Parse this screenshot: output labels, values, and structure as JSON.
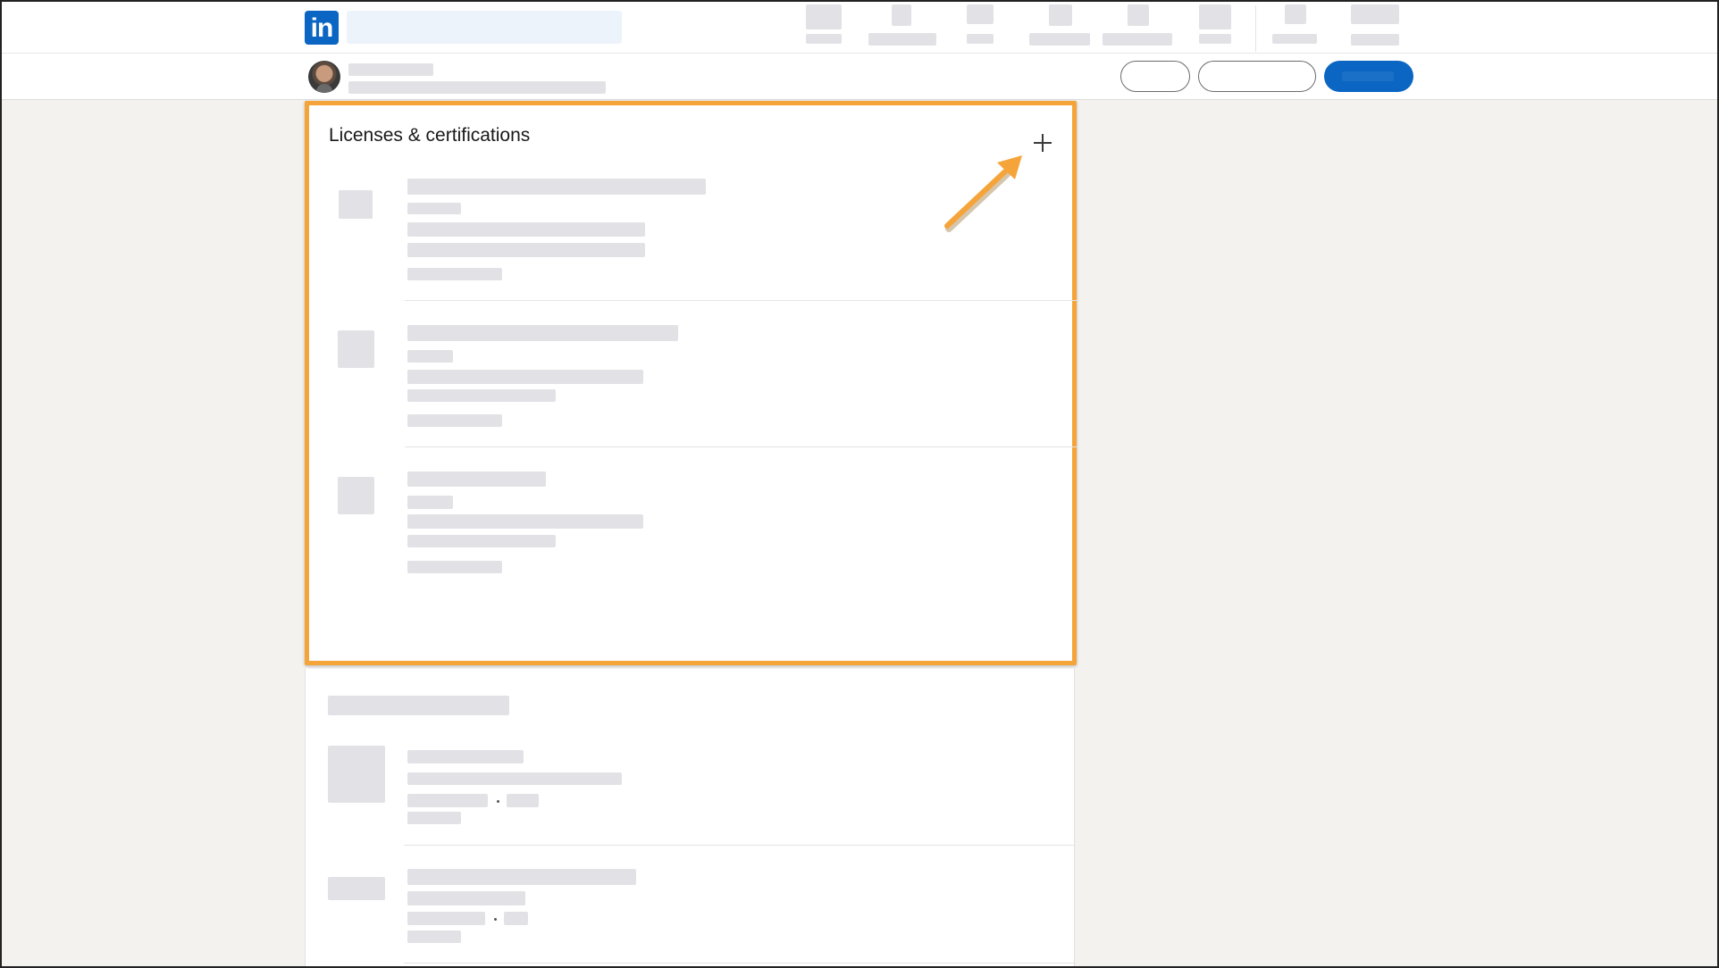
{
  "brand": {
    "logo_text": "in",
    "color": "#0a66c2"
  },
  "licenses_section": {
    "title": "Licenses & certifications",
    "add_button_symbol": "+",
    "highlight_color": "#f5a43a",
    "arrow_color": "#f5a43a"
  },
  "icons": {
    "logo": "linkedin-logo",
    "add": "plus-icon",
    "annotation": "pointer-arrow"
  },
  "colors": {
    "placeholder": "#e2e2e6",
    "page_background": "#f3f2ef",
    "primary_button": "#0a66c2"
  }
}
